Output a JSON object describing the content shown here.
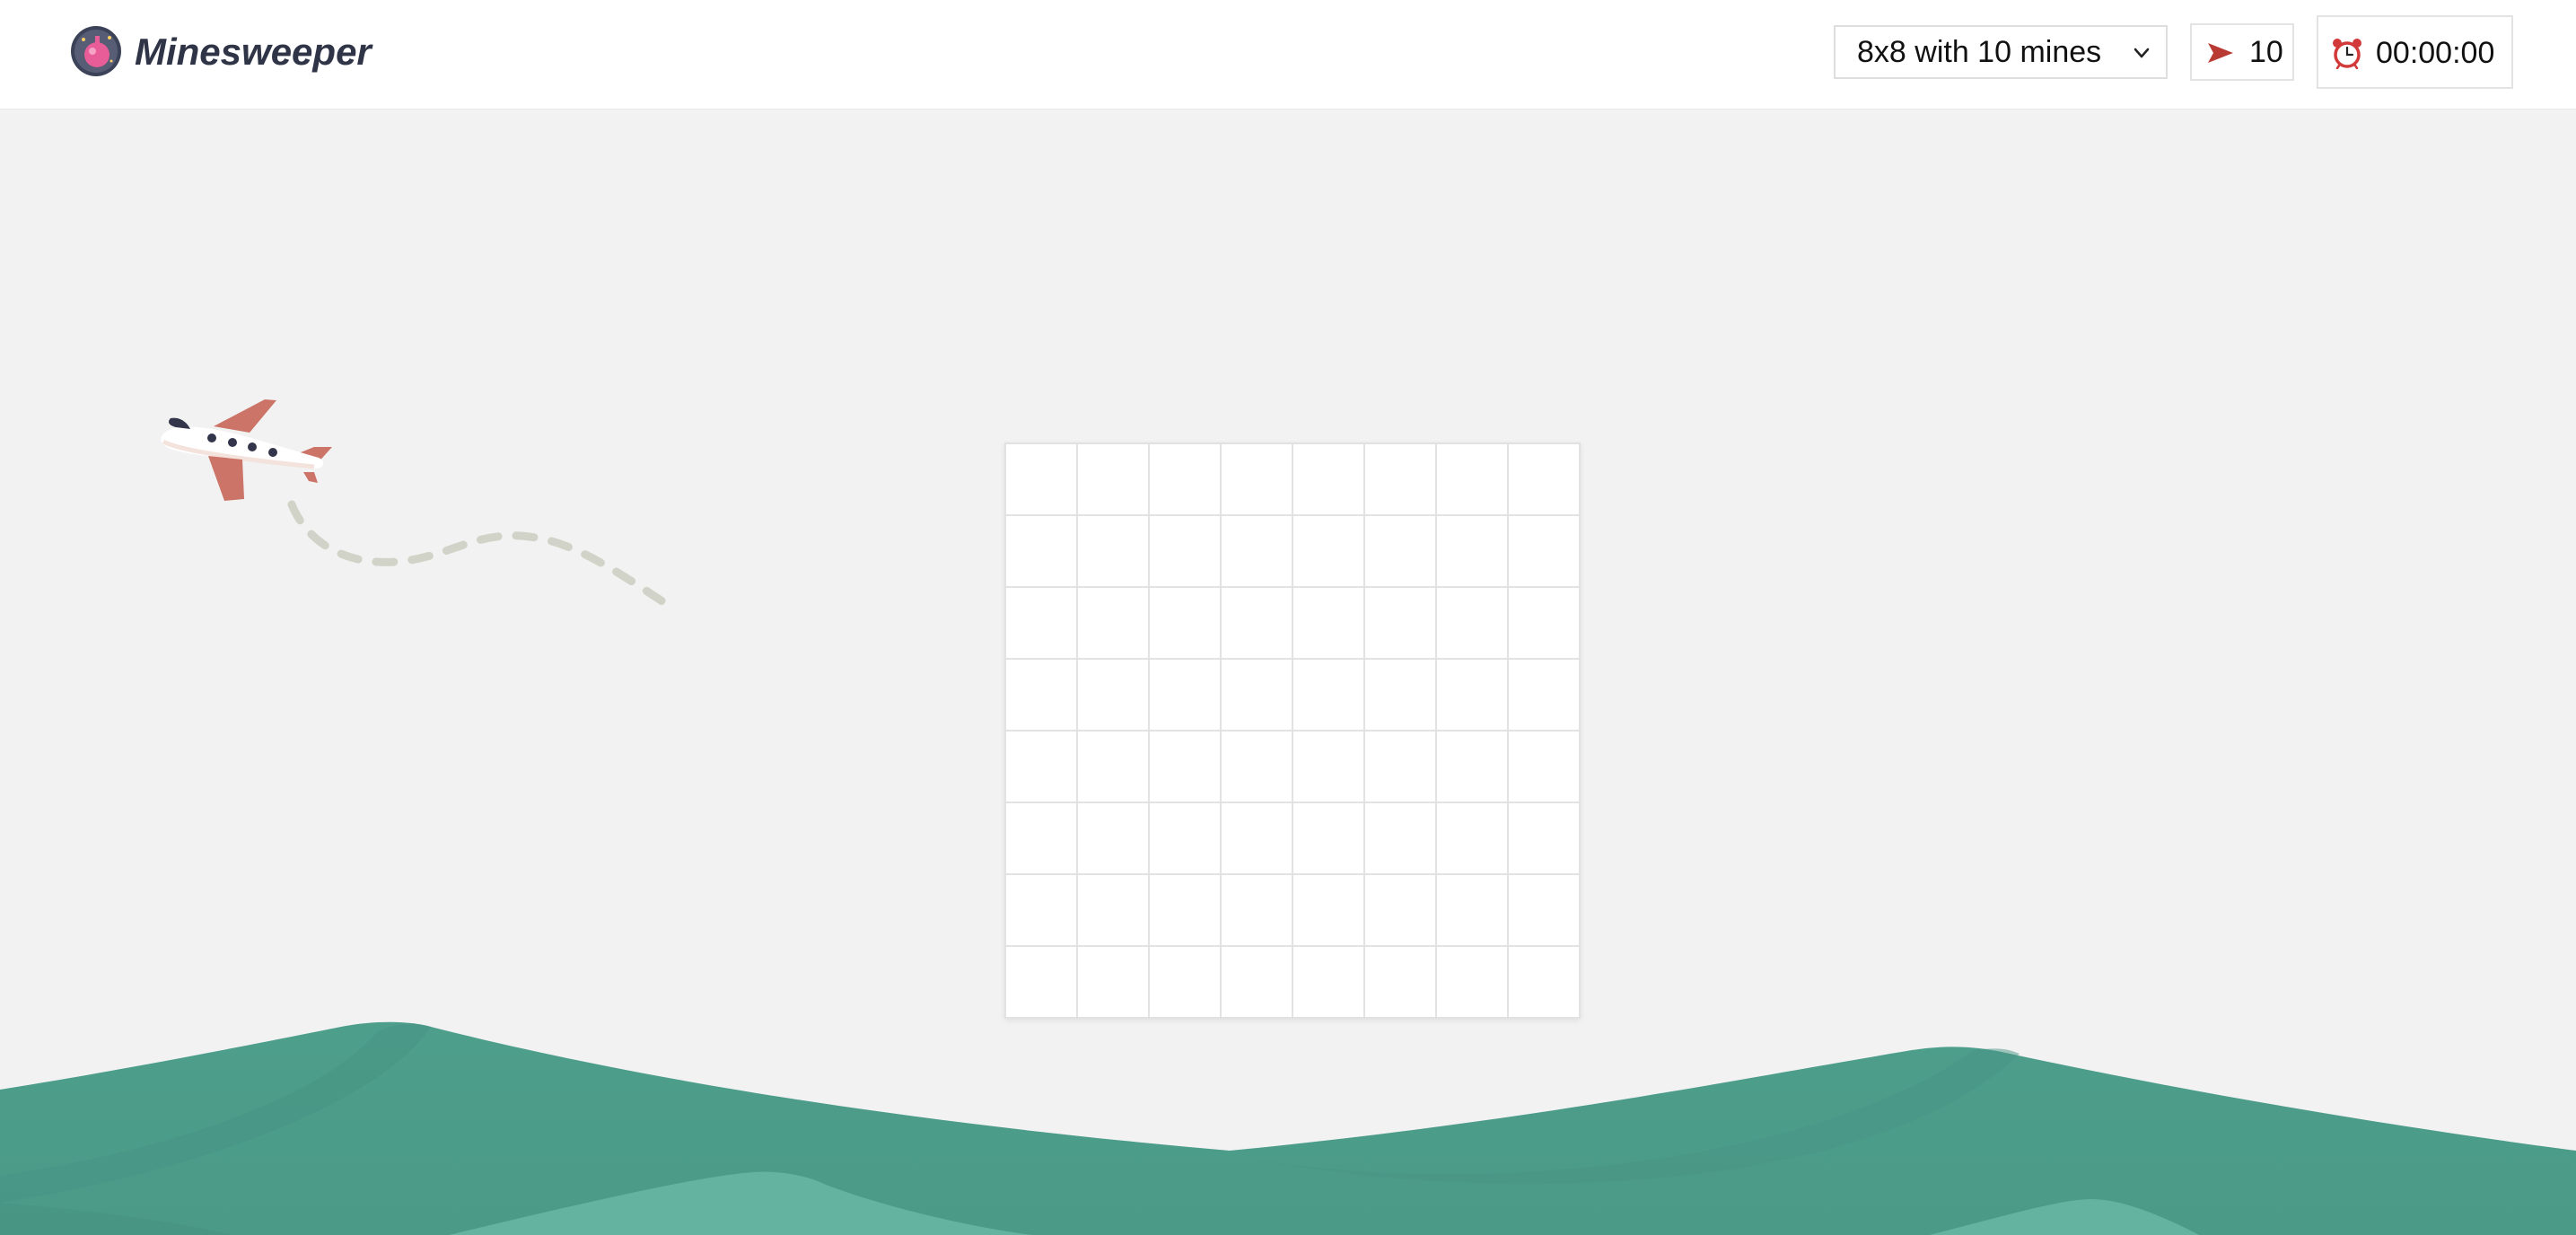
{
  "header": {
    "title": "Minesweeper",
    "logo_icon": "bomb-logo-icon",
    "difficulty": {
      "selected": "8x8 with 10 mines",
      "icon": "chevron-down-icon"
    },
    "flags": {
      "icon": "red-flag-icon",
      "count": "10"
    },
    "timer": {
      "icon": "alarm-clock-icon",
      "value": "00:00:00"
    }
  },
  "board": {
    "rows": 8,
    "columns": 8,
    "mines": 10,
    "state": "all cells unrevealed"
  },
  "decorations": {
    "plane_icon": "airplane-illustration",
    "hills": "green-hills-illustration"
  },
  "colors": {
    "background": "#f2f2f2",
    "header": "#ffffff",
    "title": "#2f3447",
    "cell": "#ffffff",
    "grid_line": "#e2e2e2",
    "hill": "#4e9e8c",
    "flag": "#c0392b"
  }
}
